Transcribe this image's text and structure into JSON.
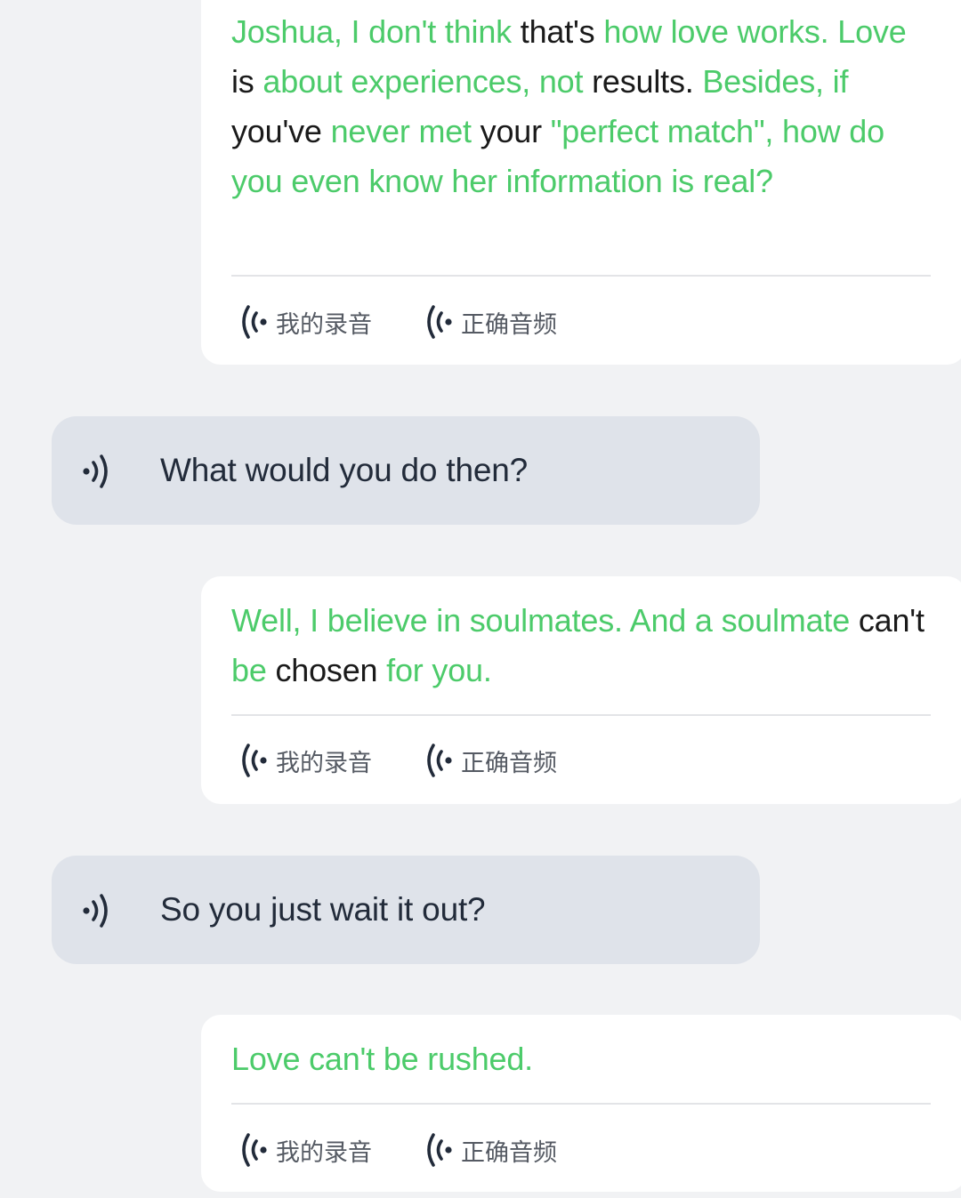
{
  "colors": {
    "correct_word": "#4ccb6a",
    "incorrect_word": "#1a1a1a",
    "ai_bubble_bg": "#dfe3ea",
    "page_bg": "#f1f2f4"
  },
  "icons": {
    "recording": "sound-wave-left-icon",
    "ai_speaker": "speaker-right-icon"
  },
  "messages": [
    {
      "role": "user",
      "words": [
        {
          "t": "Joshua,",
          "ok": true
        },
        {
          "t": "I",
          "ok": true
        },
        {
          "t": "don't",
          "ok": true
        },
        {
          "t": "think",
          "ok": true
        },
        {
          "t": "that's",
          "ok": false
        },
        {
          "t": "how",
          "ok": true
        },
        {
          "t": "love",
          "ok": true
        },
        {
          "t": "works.",
          "ok": true
        },
        {
          "t": "Love",
          "ok": true
        },
        {
          "t": "is",
          "ok": false
        },
        {
          "t": "about",
          "ok": true
        },
        {
          "t": "experiences,",
          "ok": true
        },
        {
          "t": "not",
          "ok": true
        },
        {
          "t": "results.",
          "ok": false
        },
        {
          "t": "Besides,",
          "ok": true
        },
        {
          "t": "if",
          "ok": true
        },
        {
          "t": "you've",
          "ok": false
        },
        {
          "t": "never",
          "ok": true
        },
        {
          "t": "met",
          "ok": true
        },
        {
          "t": "your",
          "ok": false
        },
        {
          "t": "\"perfect",
          "ok": true
        },
        {
          "t": "match\",",
          "ok": true
        },
        {
          "t": "how",
          "ok": true
        },
        {
          "t": "do",
          "ok": true
        },
        {
          "t": "you",
          "ok": true
        },
        {
          "t": "even",
          "ok": true
        },
        {
          "t": "know",
          "ok": true
        },
        {
          "t": "her",
          "ok": true
        },
        {
          "t": "information",
          "ok": true
        },
        {
          "t": "is",
          "ok": true
        },
        {
          "t": "real?",
          "ok": true
        }
      ],
      "my_recording_label": "我的录音",
      "correct_audio_label": "正确音频"
    },
    {
      "role": "ai",
      "text": "What would you do then?"
    },
    {
      "role": "user",
      "words": [
        {
          "t": "Well,",
          "ok": true
        },
        {
          "t": "I",
          "ok": true
        },
        {
          "t": "believe",
          "ok": true
        },
        {
          "t": "in",
          "ok": true
        },
        {
          "t": "soulmates.",
          "ok": true
        },
        {
          "t": "And",
          "ok": true
        },
        {
          "t": "a",
          "ok": true
        },
        {
          "t": "soulmate",
          "ok": true
        },
        {
          "t": "can't",
          "ok": false
        },
        {
          "t": "be",
          "ok": true
        },
        {
          "t": "chosen",
          "ok": false
        },
        {
          "t": "for",
          "ok": true
        },
        {
          "t": "you.",
          "ok": true
        }
      ],
      "my_recording_label": "我的录音",
      "correct_audio_label": "正确音频"
    },
    {
      "role": "ai",
      "text": "So you just wait it out?"
    },
    {
      "role": "user",
      "words": [
        {
          "t": "Love",
          "ok": true
        },
        {
          "t": "can't",
          "ok": true
        },
        {
          "t": "be",
          "ok": true
        },
        {
          "t": "rushed.",
          "ok": true
        }
      ],
      "my_recording_label": "我的录音",
      "correct_audio_label": "正确音频"
    }
  ]
}
